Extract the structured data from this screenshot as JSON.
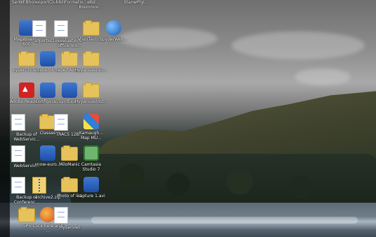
{
  "desktop": {
    "top_labels": [
      "SerWEBhole...",
      "soportClu...",
      "bibliFormatio",
      "eBd Bremmon...",
      "StanwPlgl..."
    ],
    "rows": [
      [
        "MapWisema 600",
        "soporteClu...",
        "evaluations office mo...",
        "VisorTestin...",
        "SpyderWeb..."
      ],
      [
        "SyperClinte...",
        "SyberSh...",
        "repertAuto...",
        "Hyyanuavinst..."
      ],
      [
        "Adobe Reader 8",
        "Configura...",
        "LyntExa...",
        "Hyyanuavinst..."
      ],
      [
        "Backup of WebServic...",
        "Classes",
        "TRACS 12B...",
        "Kamaugh... Map MU..."
      ],
      [
        "WebServic...",
        "snow-euro...",
        "MiloManic",
        "Camtasia Studio 7"
      ],
      [
        "Backup of Conferenc...",
        "archive2.zip",
        "Photo of list",
        "capture 1.avi"
      ],
      [
        "GPS",
        "Click here and ...",
        "MyServlet"
      ]
    ]
  },
  "icons": {
    "folder": "folder-icon",
    "doc": "document-icon",
    "app": "application-icon",
    "pdf": "pdf-icon",
    "globe": "globe-icon",
    "zip": "zip-icon",
    "map": "map-icon",
    "camtasia": "camtasia-icon",
    "firefox": "browser-icon"
  }
}
